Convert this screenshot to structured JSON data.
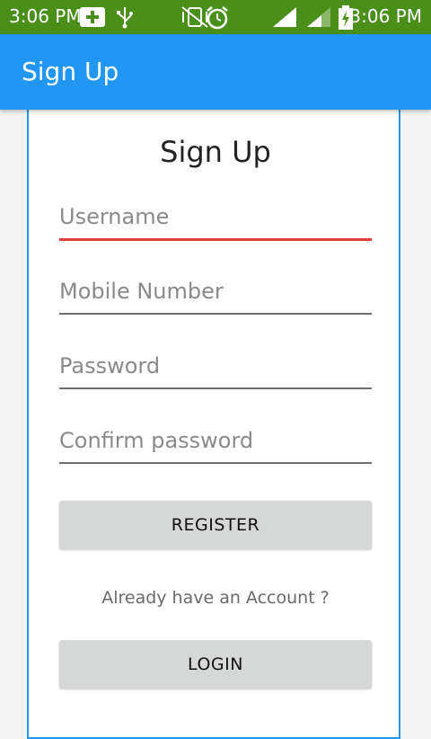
{
  "status_bar": {
    "time_left": "3:06 PM",
    "time_right": "3:06 PM",
    "icons": [
      "add-icon",
      "usb-icon",
      "vibrate-icon",
      "alarm-icon",
      "signal-icon",
      "signal-icon",
      "battery-charging-icon"
    ]
  },
  "app_bar": {
    "title": "Sign Up"
  },
  "form": {
    "heading": "Sign Up",
    "fields": [
      {
        "placeholder": "Username"
      },
      {
        "placeholder": "Mobile Number"
      },
      {
        "placeholder": "Password"
      },
      {
        "placeholder": "Confirm password"
      }
    ],
    "register_label": "REGISTER",
    "already_text": "Already have an Account ?",
    "login_label": "LOGIN"
  },
  "colors": {
    "status_bar": "#4a8f1a",
    "app_bar": "#2196f3",
    "active_underline": "#e0413a",
    "button_bg": "#d6d7d7"
  }
}
